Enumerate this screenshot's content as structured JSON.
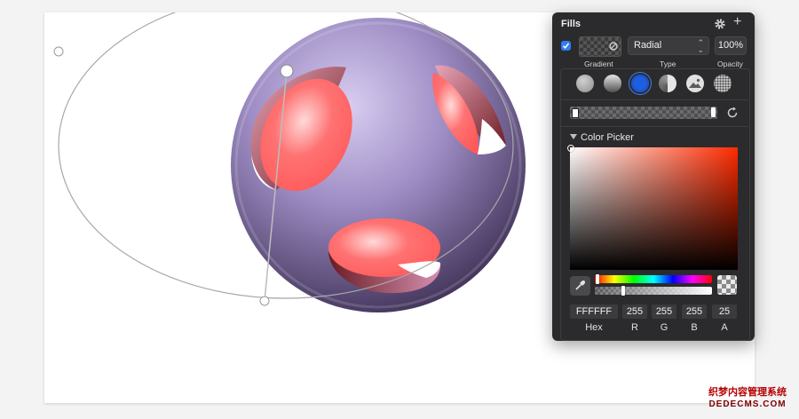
{
  "fills_panel": {
    "title": "Fills",
    "enabled": true,
    "fill_type": "Radial",
    "opacity": "100%",
    "labels": {
      "gradient": "Gradient",
      "type": "Type",
      "opacity": "Opacity"
    },
    "gradient_types": [
      {
        "icon": "solid-fill-icon",
        "selected": false
      },
      {
        "icon": "linear-gradient-icon",
        "selected": false
      },
      {
        "icon": "radial-gradient-icon",
        "selected": true
      },
      {
        "icon": "angular-gradient-icon",
        "selected": false
      },
      {
        "icon": "image-fill-icon",
        "selected": false
      },
      {
        "icon": "noise-fill-icon",
        "selected": false
      }
    ],
    "color_picker": {
      "title": "Color Picker",
      "hex": "FFFFFF",
      "r": "255",
      "g": "255",
      "b": "255",
      "a": "25",
      "labels": {
        "hex": "Hex",
        "r": "R",
        "g": "G",
        "b": "B",
        "a": "A"
      }
    }
  },
  "watermark": {
    "line1": "织梦内容管理系统",
    "line2": "DEDECMS.COM"
  },
  "colors": {
    "accent": "#2f7cf6",
    "panel_bg": "#2b2b2d",
    "sphere": "#9b87c0",
    "hole": "#ff6f6f"
  }
}
